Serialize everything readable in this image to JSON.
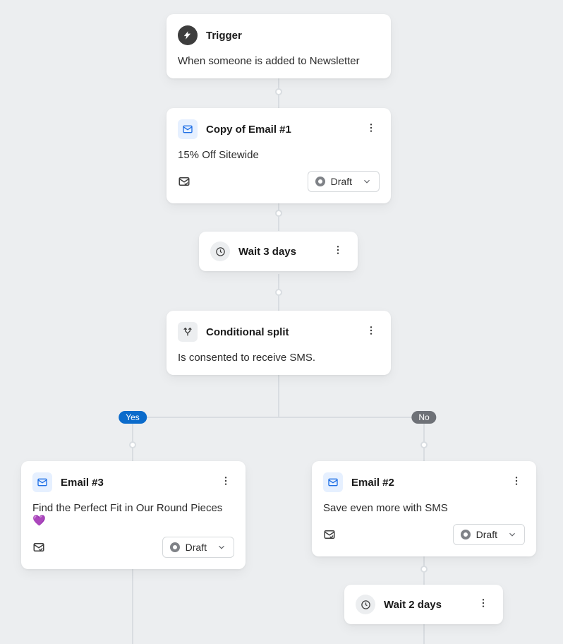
{
  "trigger": {
    "title": "Trigger",
    "description": "When someone is added to Newsletter"
  },
  "email1": {
    "title": "Copy of Email #1",
    "subject": "15% Off Sitewide",
    "status": "Draft"
  },
  "wait1": {
    "label": "Wait 3 days"
  },
  "split": {
    "title": "Conditional split",
    "condition": "Is consented to receive SMS.",
    "yes_label": "Yes",
    "no_label": "No"
  },
  "email3": {
    "title": "Email #3",
    "subject": "Find the Perfect Fit in Our Round Pieces 💜",
    "status": "Draft"
  },
  "email2": {
    "title": "Email #2",
    "subject": "Save even more with SMS",
    "status": "Draft"
  },
  "wait2": {
    "label": "Wait 2 days"
  }
}
